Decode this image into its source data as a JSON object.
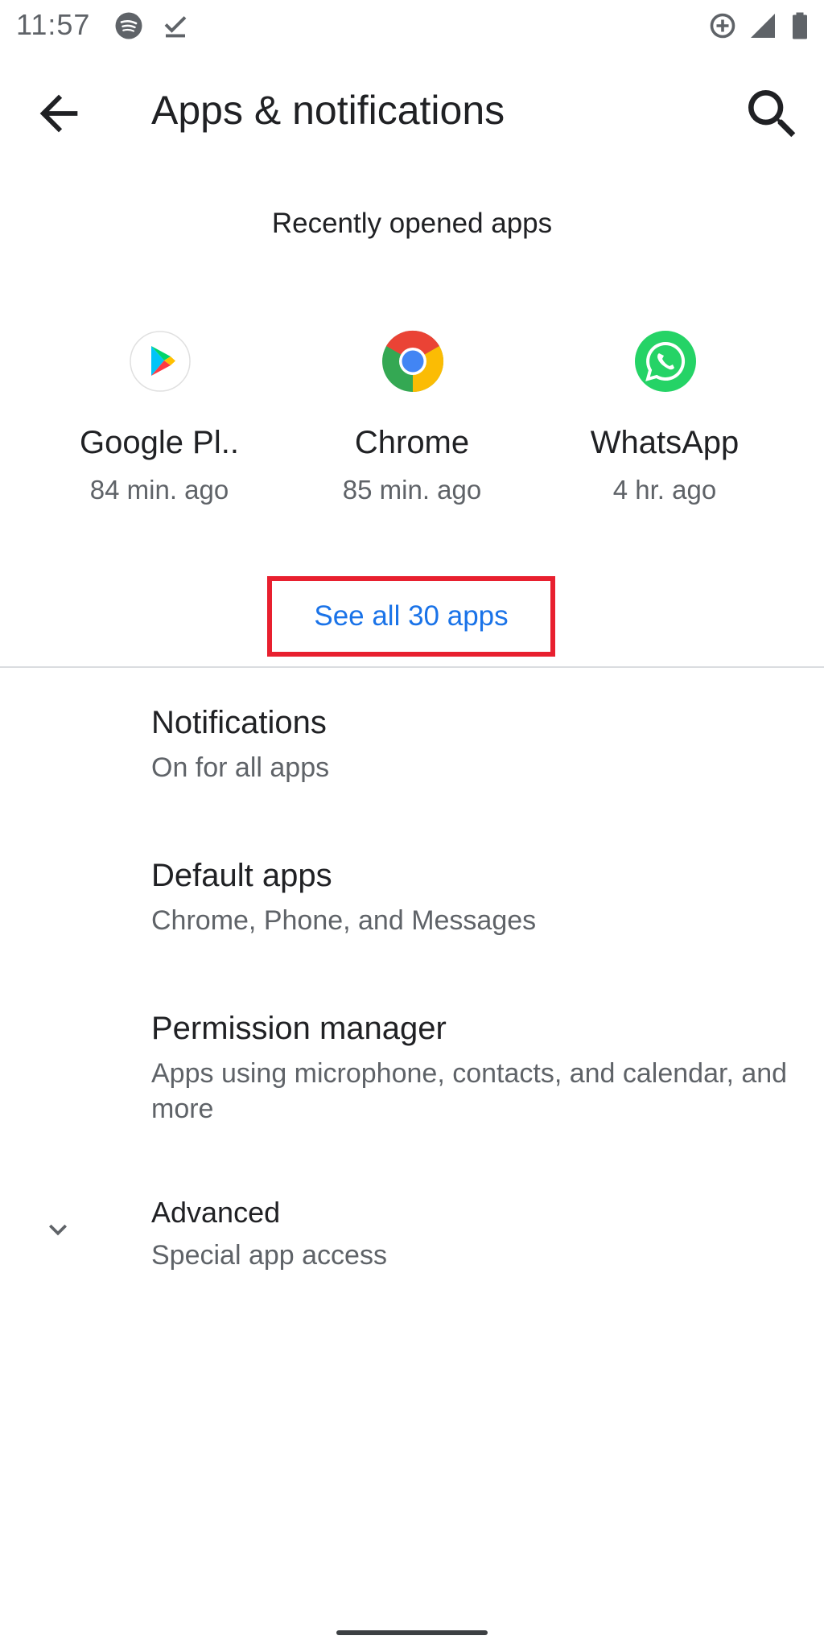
{
  "status_bar": {
    "time": "11:57",
    "icons_left": [
      "spotify-icon",
      "download-done-icon"
    ],
    "icons_right": [
      "data-saver-icon",
      "cell-signal-icon",
      "battery-icon"
    ]
  },
  "app_bar": {
    "title": "Apps & notifications",
    "back_icon": "arrow-back-icon",
    "search_icon": "search-icon"
  },
  "recent": {
    "label": "Recently opened apps",
    "apps": [
      {
        "name": "Google Pl..",
        "time": "84 min. ago",
        "icon": "google-play-icon"
      },
      {
        "name": "Chrome",
        "time": "85 min. ago",
        "icon": "chrome-icon"
      },
      {
        "name": "WhatsApp",
        "time": "4 hr. ago",
        "icon": "whatsapp-icon"
      }
    ],
    "see_all": "See all 30 apps"
  },
  "list": {
    "notifications": {
      "title": "Notifications",
      "subtitle": "On for all apps"
    },
    "default_apps": {
      "title": "Default apps",
      "subtitle": "Chrome, Phone, and Messages"
    },
    "permissions": {
      "title": "Permission manager",
      "subtitle": "Apps using microphone, contacts, and calendar, and more"
    },
    "advanced": {
      "title": "Advanced",
      "subtitle": "Special app access",
      "icon": "chevron-down-icon"
    }
  },
  "colors": {
    "accent": "#1a73e8",
    "highlight_border": "#e8202f",
    "primary_text": "#202124",
    "secondary_text": "#5f6368",
    "whatsapp_green": "#25d366"
  }
}
